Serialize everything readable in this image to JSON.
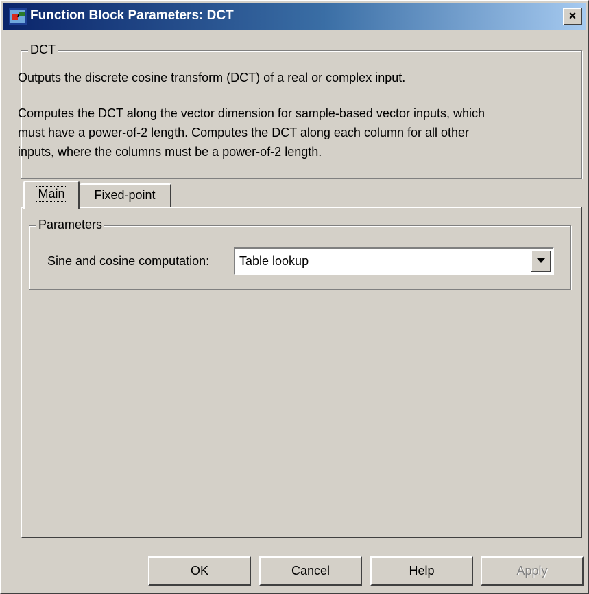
{
  "window": {
    "title": "Function Block Parameters: DCT",
    "close_glyph": "×",
    "icon": "simulink-block-icon"
  },
  "description_group": {
    "legend": "DCT",
    "lines": [
      "Outputs the discrete cosine transform (DCT) of a real or complex input.",
      "",
      "Computes the DCT along the vector dimension for sample-based vector inputs, which",
      "must have a power-of-2 length. Computes the DCT along each column for all other",
      "inputs, where the columns must be a power-of-2 length."
    ]
  },
  "tabs": [
    {
      "label": "Main",
      "selected": true
    },
    {
      "label": "Fixed-point",
      "selected": false
    }
  ],
  "parameters_group": {
    "legend": "Parameters",
    "sine_cosine_label": "Sine and cosine computation:",
    "sine_cosine_value": "Table lookup"
  },
  "buttons": {
    "ok": "OK",
    "cancel": "Cancel",
    "help": "Help",
    "apply": "Apply",
    "apply_enabled": false
  },
  "colors": {
    "face": "#d4d0c8",
    "title_gradient_start": "#0a246a",
    "title_gradient_end": "#a6caf0"
  }
}
